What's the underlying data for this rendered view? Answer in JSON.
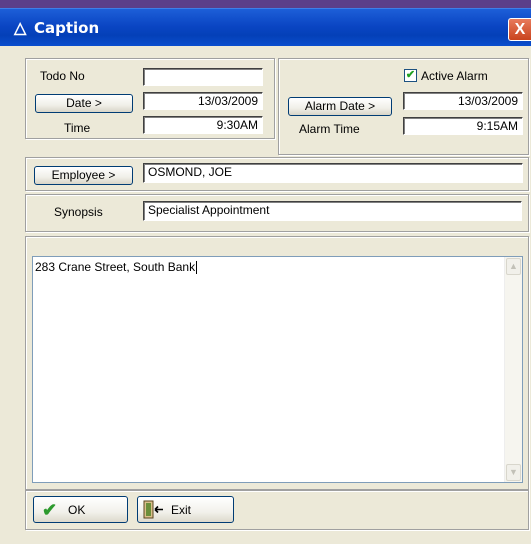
{
  "window": {
    "title": "Caption",
    "close_glyph": "X",
    "title_icon": "triangle-icon"
  },
  "todo": {
    "label": "Todo No",
    "value": ""
  },
  "date": {
    "button_label": "Date >",
    "value": "13/03/2009"
  },
  "time": {
    "label": "Time",
    "value": "9:30AM"
  },
  "alarm": {
    "active_label": "Active Alarm",
    "active_checked": true,
    "date_button_label": "Alarm Date >",
    "date_value": "13/03/2009",
    "time_label": "Alarm Time",
    "time_value": "9:15AM"
  },
  "employee": {
    "button_label": "Employee >",
    "value": "OSMOND, JOE"
  },
  "synopsis": {
    "label": "Synopsis",
    "value": "Specialist Appointment"
  },
  "notes": {
    "text": "283 Crane Street, South Bank"
  },
  "footer": {
    "ok_label": "OK",
    "exit_label": "Exit"
  }
}
